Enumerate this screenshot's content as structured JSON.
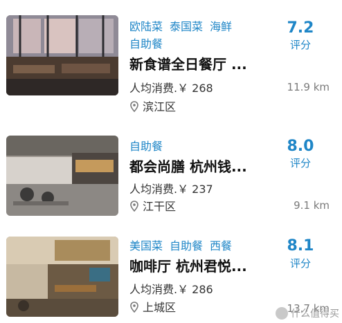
{
  "restaurants": [
    {
      "tags": [
        "欧陆菜",
        "泰国菜",
        "海鲜"
      ],
      "tag_line2": "自助餐",
      "title": "新食谱全日餐厅 ...",
      "price": "人均消费.￥ 268",
      "district": "滨江区",
      "score": "7.2",
      "score_label": "评分",
      "distance": "11.9 km"
    },
    {
      "tags": [
        "自助餐"
      ],
      "tag_line2": "",
      "title": "都会尚膳 杭州钱...",
      "price": "人均消费.￥ 237",
      "district": "江干区",
      "score": "8.0",
      "score_label": "评分",
      "distance": "9.1 km"
    },
    {
      "tags": [
        "美国菜",
        "自助餐",
        "西餐"
      ],
      "tag_line2": "",
      "title": "咖啡厅 杭州君悦...",
      "price": "人均消费.￥ 286",
      "district": "上城区",
      "score": "8.1",
      "score_label": "评分",
      "distance": "13.7 km"
    }
  ],
  "watermark": "什么值得买",
  "colors": {
    "accent": "#1f86c7",
    "distance": "#7a7a7a"
  },
  "icons": {
    "location": "location-pin-icon"
  }
}
